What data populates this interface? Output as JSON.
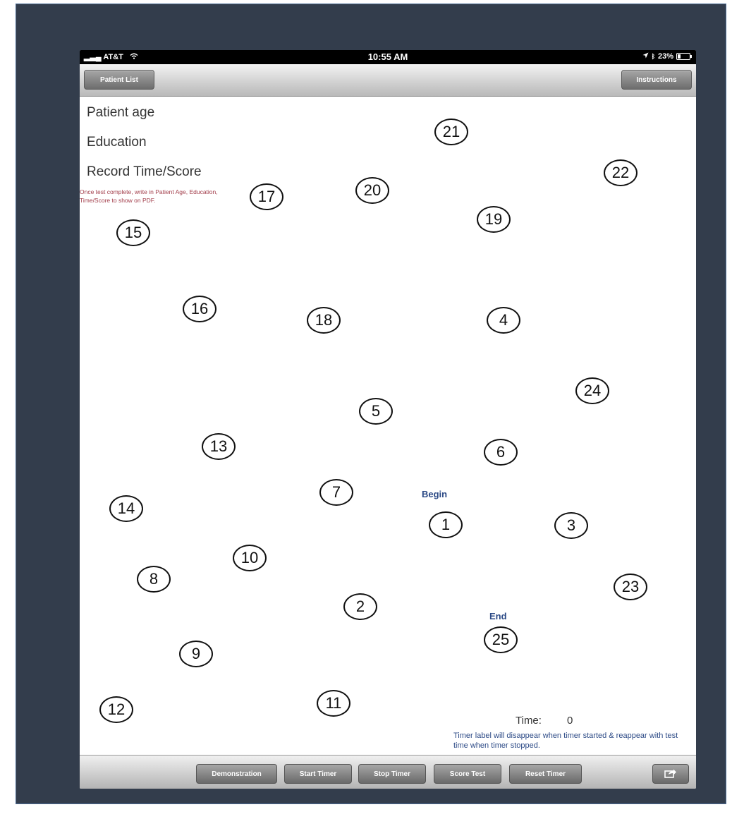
{
  "status_bar": {
    "carrier": "AT&T",
    "time": "10:55 AM",
    "battery": "23%"
  },
  "nav": {
    "left_button": "Patient List",
    "right_button": "Instructions"
  },
  "form": {
    "age_label": "Patient age",
    "education_label": "Education",
    "record_label": "Record Time/Score",
    "note": "Once test complete, write in Patient Age, Education, Time/Score to show on PDF."
  },
  "test": {
    "begin_label": "Begin",
    "end_label": "End",
    "circles": [
      "1",
      "2",
      "3",
      "4",
      "5",
      "6",
      "7",
      "8",
      "9",
      "10",
      "11",
      "12",
      "13",
      "14",
      "15",
      "16",
      "17",
      "18",
      "19",
      "20",
      "21",
      "22",
      "23",
      "24",
      "25"
    ]
  },
  "timer": {
    "label": "Time:",
    "value": "0",
    "note": "Timer label will disappear when timer started & reappear with test time when timer stopped."
  },
  "toolbar": {
    "demonstration": "Demonstration",
    "start_timer": "Start Timer",
    "stop_timer": "Stop Timer",
    "score_test": "Score Test",
    "reset_timer": "Reset Timer"
  },
  "icons": {
    "share": "share-icon",
    "wifi": "wifi-icon",
    "location": "location-arrow-icon",
    "bluetooth": "bluetooth-icon",
    "battery": "battery-icon"
  }
}
